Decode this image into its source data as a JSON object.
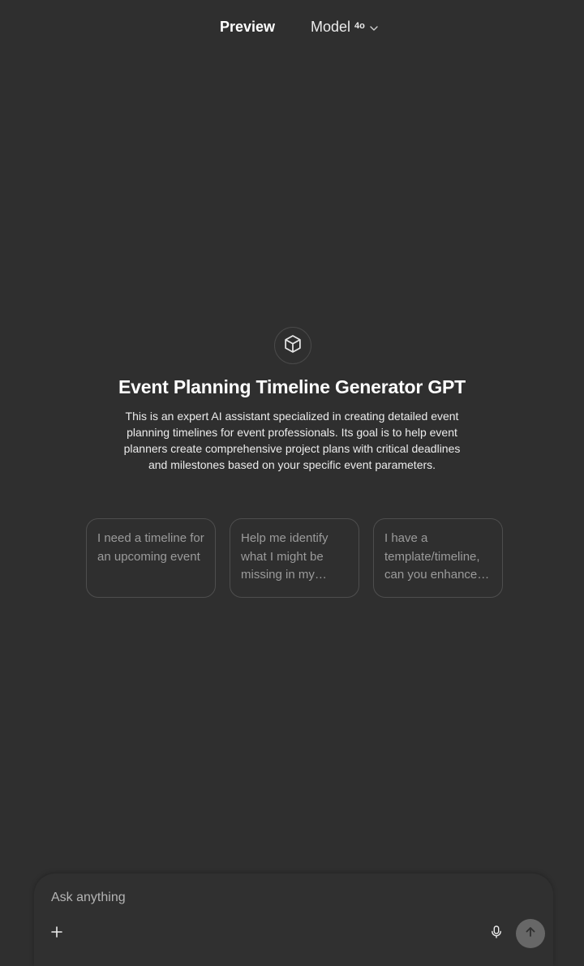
{
  "header": {
    "preview_label": "Preview",
    "model_label": "Model",
    "model_version": "4o"
  },
  "gpt": {
    "icon": "cube-icon",
    "title": "Event Planning Timeline Generator GPT",
    "description": "This is an expert AI assistant specialized in creating detailed event planning timelines for event professionals. Its goal is to help event planners create comprehensive project plans with critical deadlines and milestones based on your specific event parameters."
  },
  "suggestions": [
    {
      "text": "I need a timeline for an upcoming event"
    },
    {
      "text": "Help me identify what I might be missing in my…"
    },
    {
      "text": "I have a template/timeline, can you enhance…"
    }
  ],
  "composer": {
    "placeholder": "Ask anything",
    "value": "",
    "icons": [
      "plus-icon",
      "microphone-icon",
      "arrow-up-icon"
    ]
  },
  "colors": {
    "background": "#2f2f2f",
    "card_border": "#4e4e4e",
    "muted_text": "#9b9b9b",
    "send_button": "#676767"
  }
}
